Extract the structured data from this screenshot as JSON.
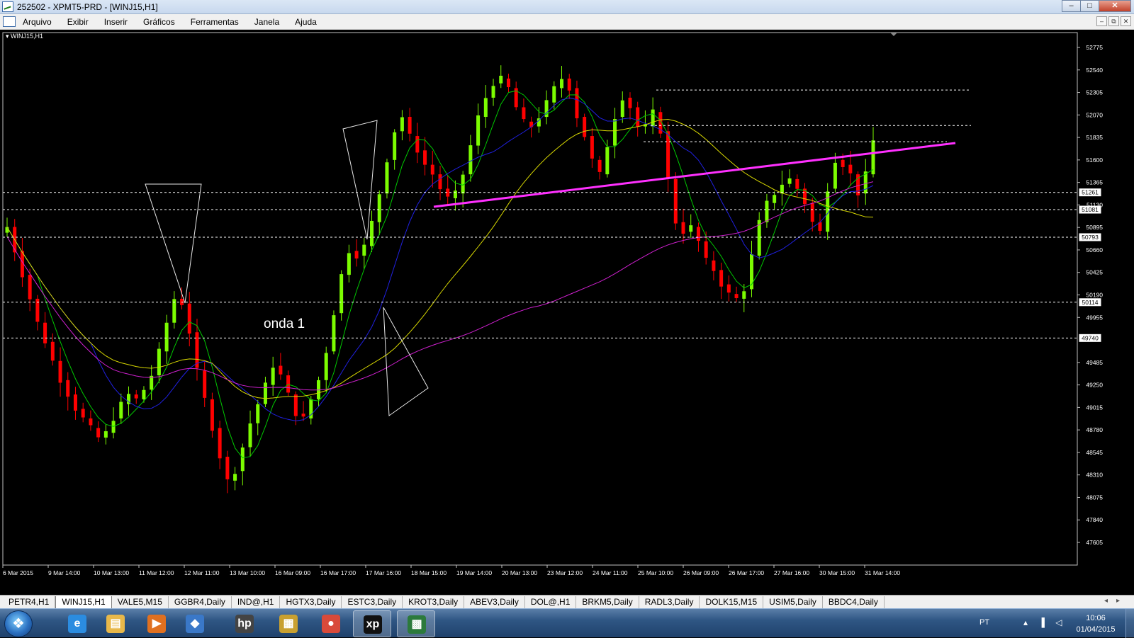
{
  "window": {
    "title": "252502 - XPMT5-PRD - [WINJ15,H1]",
    "buttons": {
      "minimize": "–",
      "maximize": "□",
      "close": "✕"
    }
  },
  "menu": {
    "items": [
      "Arquivo",
      "Exibir",
      "Inserir",
      "Gráficos",
      "Ferramentas",
      "Janela",
      "Ajuda"
    ],
    "mdi_buttons": [
      "–",
      "⧉",
      "✕"
    ]
  },
  "chart": {
    "label": "WINJ15,H1",
    "annotation": "onda 1",
    "colors": {
      "bull": "#7cfc00",
      "bear": "#ff0000",
      "ma_fast": "#00c800",
      "ma_mid": "#2020e0",
      "ma_slow": "#d8d800",
      "ma_long": "#d020d0",
      "trendline": "#ff30ff",
      "level": "#ffffff"
    },
    "price_axis": [
      "52775",
      "52540",
      "52305",
      "52070",
      "51835",
      "51600",
      "51365",
      "51130",
      "50895",
      "50660",
      "50425",
      "50190",
      "49955",
      "49485",
      "49250",
      "49015",
      "48780",
      "48545",
      "48310",
      "48075",
      "47840",
      "47605"
    ],
    "price_ticks": [
      52775,
      52540,
      52305,
      52070,
      51835,
      51600,
      51365,
      51130,
      50895,
      50660,
      50425,
      50190,
      49955,
      49485,
      49250,
      49015,
      48780,
      48545,
      48310,
      48075,
      47840,
      47605
    ],
    "level_tags": [
      {
        "price": 51261,
        "text": "51261"
      },
      {
        "price": 51081,
        "text": "51081"
      },
      {
        "price": 50793,
        "text": "50793"
      },
      {
        "price": 50114,
        "text": "50114"
      },
      {
        "price": 49740,
        "text": "49740"
      }
    ],
    "time_axis": [
      "6 Mar 2015",
      "9 Mar 14:00",
      "10 Mar 13:00",
      "11 Mar 12:00",
      "12 Mar 11:00",
      "13 Mar 10:00",
      "16 Mar 09:00",
      "16 Mar 17:00",
      "17 Mar 16:00",
      "18 Mar 15:00",
      "19 Mar 14:00",
      "20 Mar 13:00",
      "23 Mar 12:00",
      "24 Mar 11:00",
      "25 Mar 10:00",
      "26 Mar 09:00",
      "26 Mar 17:00",
      "27 Mar 16:00",
      "30 Mar 15:00",
      "31 Mar 14:00"
    ],
    "price_path": [
      50900,
      50650,
      50400,
      50150,
      49900,
      49700,
      49500,
      49300,
      49150,
      49000,
      48900,
      48800,
      48700,
      48750,
      48900,
      49050,
      49150,
      49100,
      49200,
      49350,
      49600,
      49900,
      50150,
      50100,
      49800,
      49400,
      49100,
      48800,
      48500,
      48250,
      48350,
      48600,
      48850,
      49050,
      49250,
      49450,
      49350,
      49150,
      48950,
      48900,
      49100,
      49300,
      49600,
      50000,
      50400,
      50650,
      50600,
      50700,
      50950,
      51250,
      51600,
      51900,
      52050,
      51850,
      51700,
      51550,
      51450,
      51300,
      51200,
      51250,
      51450,
      51750,
      52050,
      52250,
      52400,
      52450,
      52350,
      52150,
      52000,
      51950,
      52050,
      52200,
      52350,
      52450,
      52350,
      52050,
      51850,
      51600,
      51450,
      51750,
      52050,
      52250,
      52150,
      51950,
      51950,
      52100,
      51900,
      51400,
      50950,
      50850,
      50900,
      50750,
      50550,
      50450,
      50300,
      50200,
      50150,
      50250,
      50600,
      50950,
      51150,
      51250,
      51350,
      51400,
      51300,
      51150,
      50950,
      50850,
      51300,
      51600,
      51550,
      51450,
      51250,
      51450,
      51800
    ]
  },
  "tabs": {
    "items": [
      "PETR4,H1",
      "WINJ15,H1",
      "VALE5,M15",
      "GGBR4,Daily",
      "IND@,H1",
      "HGTX3,Daily",
      "ESTC3,Daily",
      "KROT3,Daily",
      "ABEV3,Daily",
      "DOL@,H1",
      "BRKM5,Daily",
      "RADL3,Daily",
      "DOLK15,M15",
      "USIM5,Daily",
      "BBDC4,Daily"
    ],
    "active": "WINJ15,H1",
    "arrows": "◂▸"
  },
  "taskbar": {
    "apps": [
      {
        "icon": "internet-explorer-icon",
        "glyph": "e",
        "color": "#2b8ce0"
      },
      {
        "icon": "folder-icon",
        "glyph": "▤",
        "color": "#e8b84a"
      },
      {
        "icon": "media-player-icon",
        "glyph": "▶",
        "color": "#e07020"
      },
      {
        "icon": "network-icon",
        "glyph": "◆",
        "color": "#3a78c8"
      },
      {
        "icon": "hp-icon",
        "glyph": "hp",
        "color": "#444444"
      },
      {
        "icon": "archive-icon",
        "glyph": "▦",
        "color": "#c8a030"
      },
      {
        "icon": "chrome-icon",
        "glyph": "●",
        "color": "#d94a3a"
      },
      {
        "icon": "xp-icon",
        "glyph": "xp",
        "color": "#111111"
      },
      {
        "icon": "metatrader-icon",
        "glyph": "▩",
        "color": "#2c7a3c"
      }
    ],
    "language": "PT",
    "tray_glyphs": "▴ ▐ ◁",
    "time": "10:06",
    "date": "01/04/2015"
  }
}
